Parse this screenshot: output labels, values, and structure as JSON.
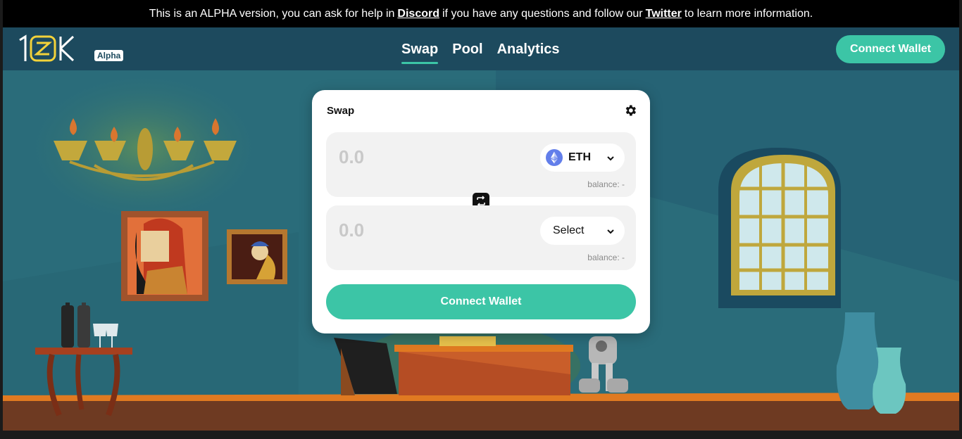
{
  "banner": {
    "text_before": "This is an ALPHA version, you can ask for help in",
    "discord_link": "Discord",
    "text_middle": "if you have any questions and follow our",
    "twitter_link": "Twitter",
    "text_after": "to learn more information."
  },
  "header": {
    "logo_text": "10K",
    "badge": "Alpha",
    "tabs": [
      {
        "label": "Swap",
        "active": true
      },
      {
        "label": "Pool",
        "active": false
      },
      {
        "label": "Analytics",
        "active": false
      }
    ],
    "connect_label": "Connect Wallet"
  },
  "swap": {
    "title": "Swap",
    "from": {
      "placeholder": "0.0",
      "token": "ETH",
      "balance": "balance: -"
    },
    "to": {
      "placeholder": "0.0",
      "token": "Select",
      "balance": "balance: -"
    },
    "connect_label": "Connect Wallet"
  },
  "colors": {
    "accent": "#3cc5a6",
    "nav_bg": "#1d4a5e",
    "banner_bg": "#000000"
  },
  "icons": {
    "settings": "gear-icon",
    "switch": "swap-arrows-icon",
    "eth": "ethereum-icon",
    "dropdown": "chevron-down-icon"
  }
}
